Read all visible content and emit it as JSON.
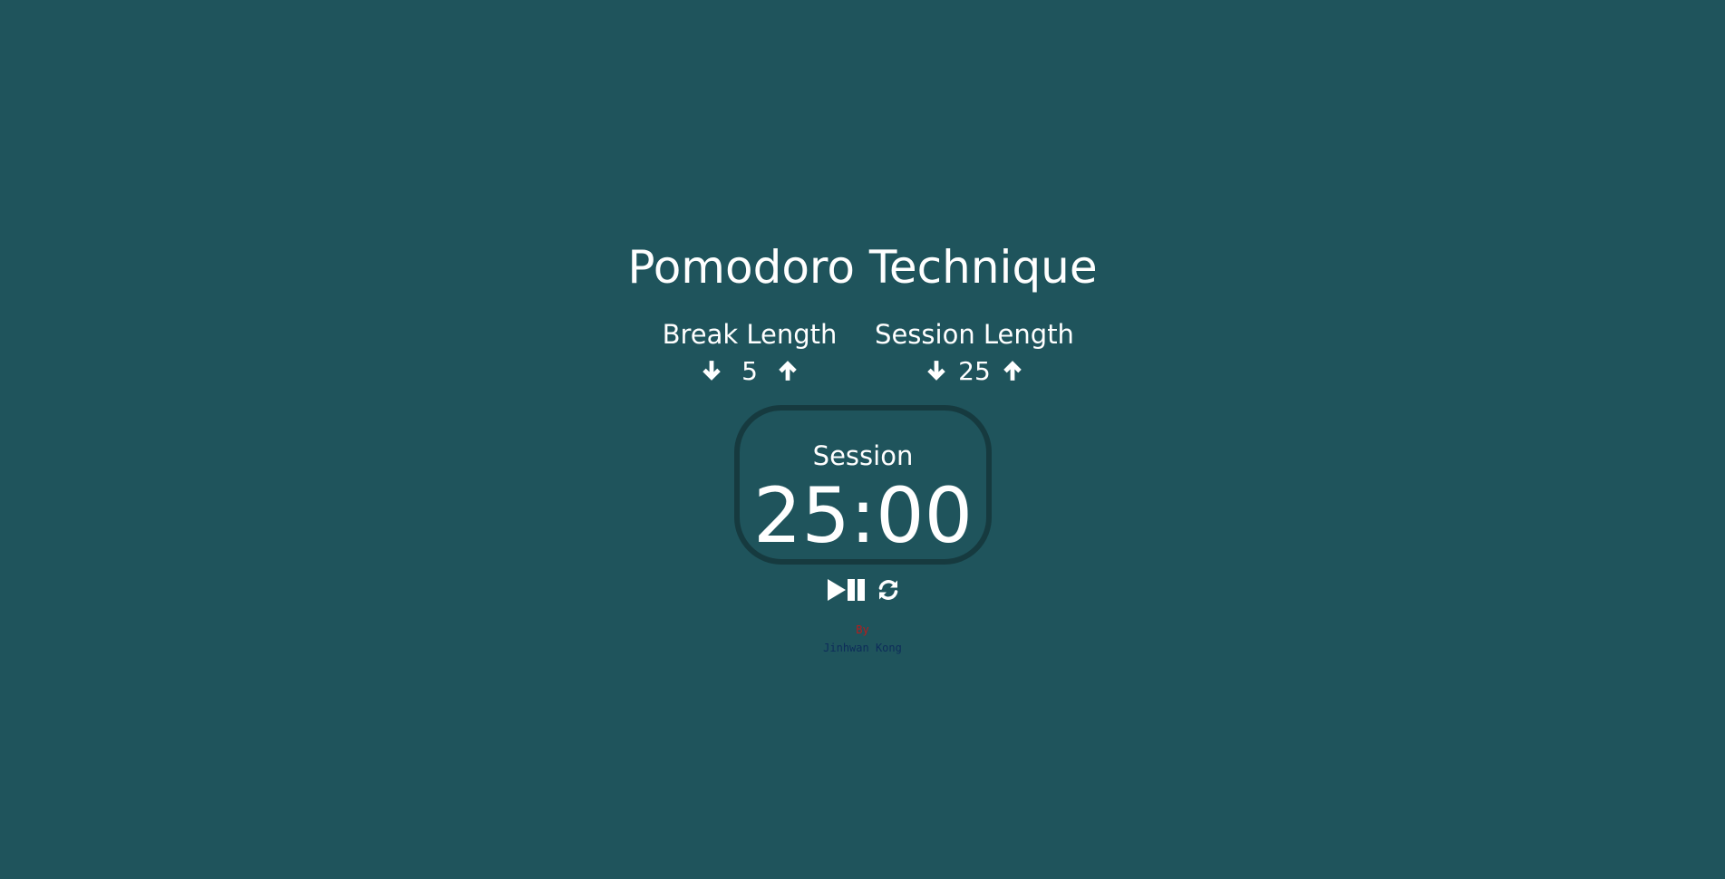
{
  "app": {
    "title": "Pomodoro Technique"
  },
  "break": {
    "label": "Break Length",
    "value": "5",
    "decrement_icon": "arrow-down-icon",
    "increment_icon": "arrow-up-icon"
  },
  "session": {
    "label": "Session Length",
    "value": "25",
    "decrement_icon": "arrow-down-icon",
    "increment_icon": "arrow-up-icon"
  },
  "timer": {
    "label": "Session",
    "time_left": "25:00"
  },
  "controls": {
    "play_pause_icon": "play-pause-icon",
    "reset_icon": "refresh-icon"
  },
  "credit": {
    "by": "By",
    "author": "Jinhwan Kong"
  },
  "colors": {
    "background": "#1f545c",
    "timer_border": "#163a3f",
    "text": "#ffffff",
    "by": "#b71c1c",
    "author": "#0d2c5a"
  }
}
